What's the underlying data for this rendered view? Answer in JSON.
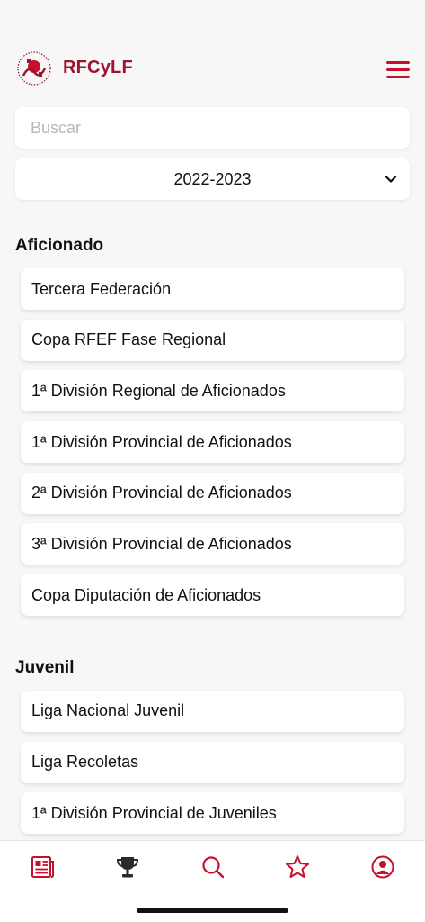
{
  "header": {
    "brand": "RFCyLF",
    "accent_color": "#c8102e",
    "brand_color": "#9b1430"
  },
  "search": {
    "placeholder": "Buscar",
    "value": ""
  },
  "season": {
    "selected": "2022-2023"
  },
  "sections": [
    {
      "title": "Aficionado",
      "items": [
        "Tercera Federación",
        "Copa RFEF Fase Regional",
        "1ª División Regional de Aficionados",
        "1ª División Provincial de Aficionados",
        "2ª División Provincial de Aficionados",
        "3ª División Provincial de Aficionados",
        "Copa Diputación de Aficionados"
      ]
    },
    {
      "title": "Juvenil",
      "items": [
        "Liga Nacional Juvenil",
        "Liga Recoletas",
        "1ª División Provincial de Juveniles",
        ""
      ]
    }
  ],
  "tabbar": {
    "tabs": [
      {
        "icon": "news-icon"
      },
      {
        "icon": "trophy-icon"
      },
      {
        "icon": "search-icon"
      },
      {
        "icon": "star-icon"
      },
      {
        "icon": "user-icon"
      }
    ]
  }
}
